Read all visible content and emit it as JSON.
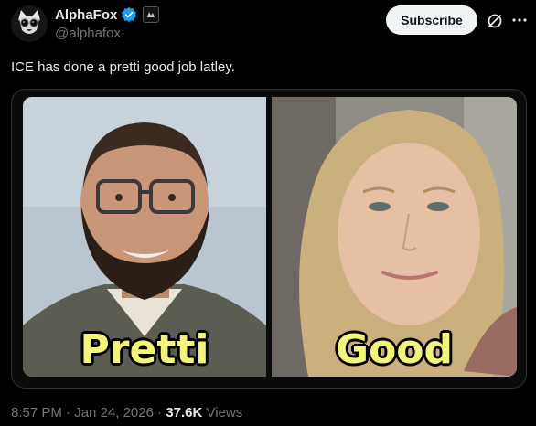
{
  "post": {
    "author": {
      "display_name": "AlphaFox",
      "handle": "@alphafox",
      "verified": true,
      "affiliate_badge_icon": "affiliate-badge-icon"
    },
    "subscribe_label": "Subscribe",
    "text": "ICE has done a pretti good job latley.",
    "media": {
      "left_caption": "Pretti",
      "right_caption": "Good"
    },
    "meta": {
      "time": "8:57 PM",
      "separator": " · ",
      "date": "Jan 24, 2026",
      "views_count": "37.6K",
      "views_label": " Views"
    }
  },
  "colors": {
    "background": "#000000",
    "text": "#e7e9ea",
    "secondary_text": "#71767b",
    "verified": "#1d9bf0",
    "caption": "#f3f57a",
    "subscribe_bg": "#eff3f4"
  }
}
